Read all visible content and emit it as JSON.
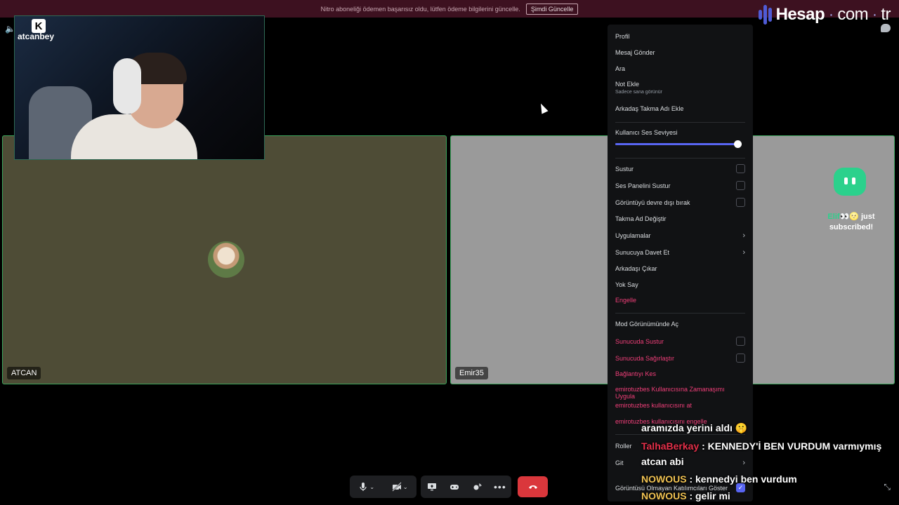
{
  "banner": {
    "text": "Nitro aboneliği ödemen başarısız oldu, lütfen ödeme bilgilerini güncelle.",
    "button": "Şimdi Güncelle"
  },
  "brand": {
    "name": "Hesap",
    "dot": "·",
    "domain": "com",
    "tld": "tr",
    "accent": "#4f5bd5"
  },
  "webcam": {
    "logo": "K",
    "channel": "atcanbey"
  },
  "tiles": {
    "left_name": "ATCAN",
    "right_name": "Emir35"
  },
  "alert": {
    "name": "Elif👀🌝",
    "text": "just subscribed!"
  },
  "menu": {
    "profile": "Profil",
    "send_message": "Mesaj Gönder",
    "call": "Ara",
    "add_note": "Not Ekle",
    "add_note_sub": "Sadece sana görünür",
    "add_friend_nickname": "Arkadaş Takma Adı Ekle",
    "user_volume": "Kullanıcı Ses Seviyesi",
    "volume_level": 1.0,
    "mute": "Sustur",
    "mute_soundboard": "Ses Panelini Sustur",
    "disable_video": "Görüntüyü devre dışı bırak",
    "change_nickname": "Takma Ad Değiştir",
    "apps": "Uygulamalar",
    "invite_to_server": "Sunucuya Davet Et",
    "remove_friend": "Arkadaşı Çıkar",
    "ignore": "Yok Say",
    "block": "Engelle",
    "open_mod_view": "Mod Görünümünde Aç",
    "server_mute": "Sunucuda Sustur",
    "server_deafen": "Sunucuda Sağırlaştır",
    "disconnect": "Bağlantıyı Kes",
    "timeout": "emirotuzbes Kullanıcısına Zamanaşımı Uygula",
    "kick": "emirotuzbes kullanıcısını at",
    "ban": "emirotuzbes kullanıcısını engelle",
    "roles": "Roller",
    "go": "Git",
    "show_non_video": "Görüntüsü Olmayan Katılımcıları Göster"
  },
  "chat": [
    {
      "user": "",
      "text": "aramızda yerini aldı 🤫"
    },
    {
      "user": "TalhaBerkay",
      "text": ": KENNEDY'İ BEN VURDUM varmıymış"
    },
    {
      "user": "",
      "text": "atcan abi"
    },
    {
      "user": "NOWOUS",
      "text": ": kennedyi ben vurdum"
    },
    {
      "user": "NOWOUS",
      "text": ": gelir mi"
    }
  ],
  "colors": {
    "danger": "#f23f7a",
    "speaking": "#3ba55c",
    "leave": "#da373c"
  }
}
